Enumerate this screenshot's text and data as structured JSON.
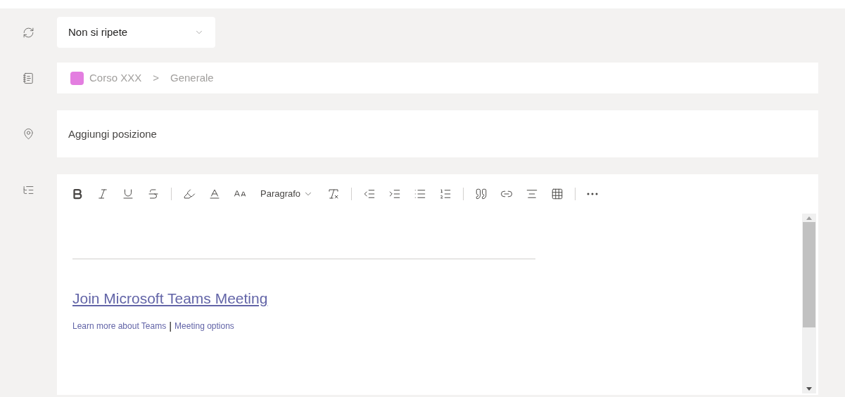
{
  "recurrence": {
    "value": "Non si ripete"
  },
  "channel": {
    "avatar": {
      "color": "#e37ee0"
    },
    "team": "Corso XXX",
    "separator": ">",
    "name": "Generale"
  },
  "location": {
    "placeholder": "Aggiungi posizione"
  },
  "toolbar": [
    {
      "kind": "button"
    },
    {
      "kind": "button"
    },
    {
      "kind": "button"
    },
    {
      "kind": "button"
    },
    {
      "kind": "separator"
    },
    {
      "kind": "button"
    },
    {
      "kind": "button"
    },
    {
      "kind": "button"
    },
    {
      "kind": "dropdown",
      "label": "Paragrafo"
    },
    {
      "kind": "button"
    },
    {
      "kind": "separator"
    },
    {
      "kind": "button"
    },
    {
      "kind": "button"
    },
    {
      "kind": "button"
    },
    {
      "kind": "button"
    },
    {
      "kind": "separator"
    },
    {
      "kind": "button"
    },
    {
      "kind": "button"
    },
    {
      "kind": "button"
    },
    {
      "kind": "button"
    },
    {
      "kind": "separator"
    },
    {
      "kind": "button"
    }
  ],
  "body": {
    "join_link": "Join Microsoft Teams Meeting",
    "links": [
      "Learn more about Teams",
      "Meeting options"
    ],
    "link_separator": "|"
  }
}
